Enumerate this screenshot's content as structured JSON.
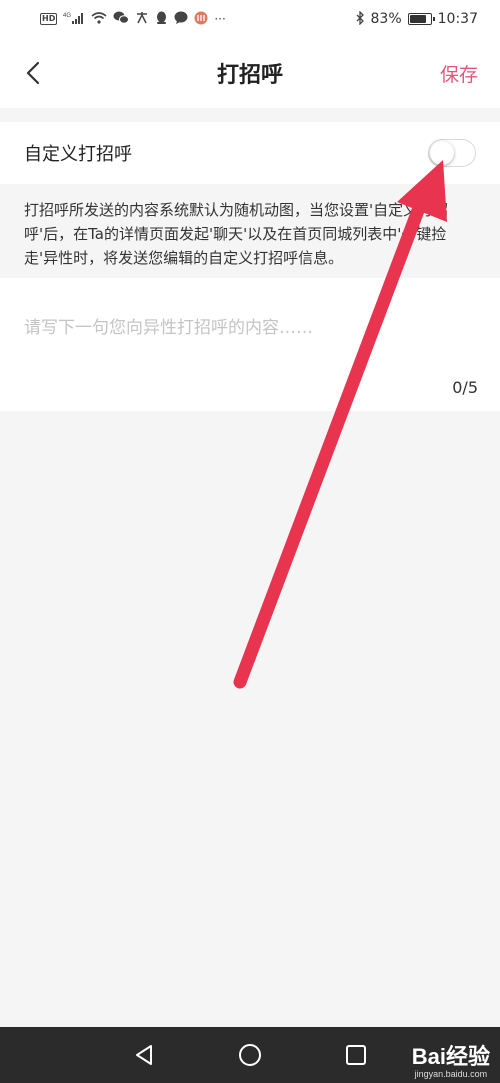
{
  "status_bar": {
    "network_type": "4G",
    "hd_badge": "HD",
    "more_indicator": "···",
    "battery_percent_label": "83%",
    "battery_level": 0.83,
    "time": "10:37"
  },
  "nav": {
    "title": "打招呼",
    "save_label": "保存"
  },
  "toggle_row": {
    "label": "自定义打招呼",
    "enabled": false
  },
  "description": "打招呼所发送的内容系统默认为随机动图，当您设置'自定义打招呼'后，在Ta的详情页面发起'聊天'以及在首页同城列表中'一键捡走'异性时，将发送您编辑的自定义打招呼信息。",
  "editor": {
    "value": "",
    "placeholder": "请写下一句您向异性打招呼的内容……",
    "counter": "0/5"
  },
  "watermark": {
    "logo": "Bai经验",
    "url": "jingyan.baidu.com"
  },
  "colors": {
    "accent": "#e5577a",
    "annotation_arrow": "#e8344f",
    "system_nav_bg": "#2b2b2b"
  }
}
